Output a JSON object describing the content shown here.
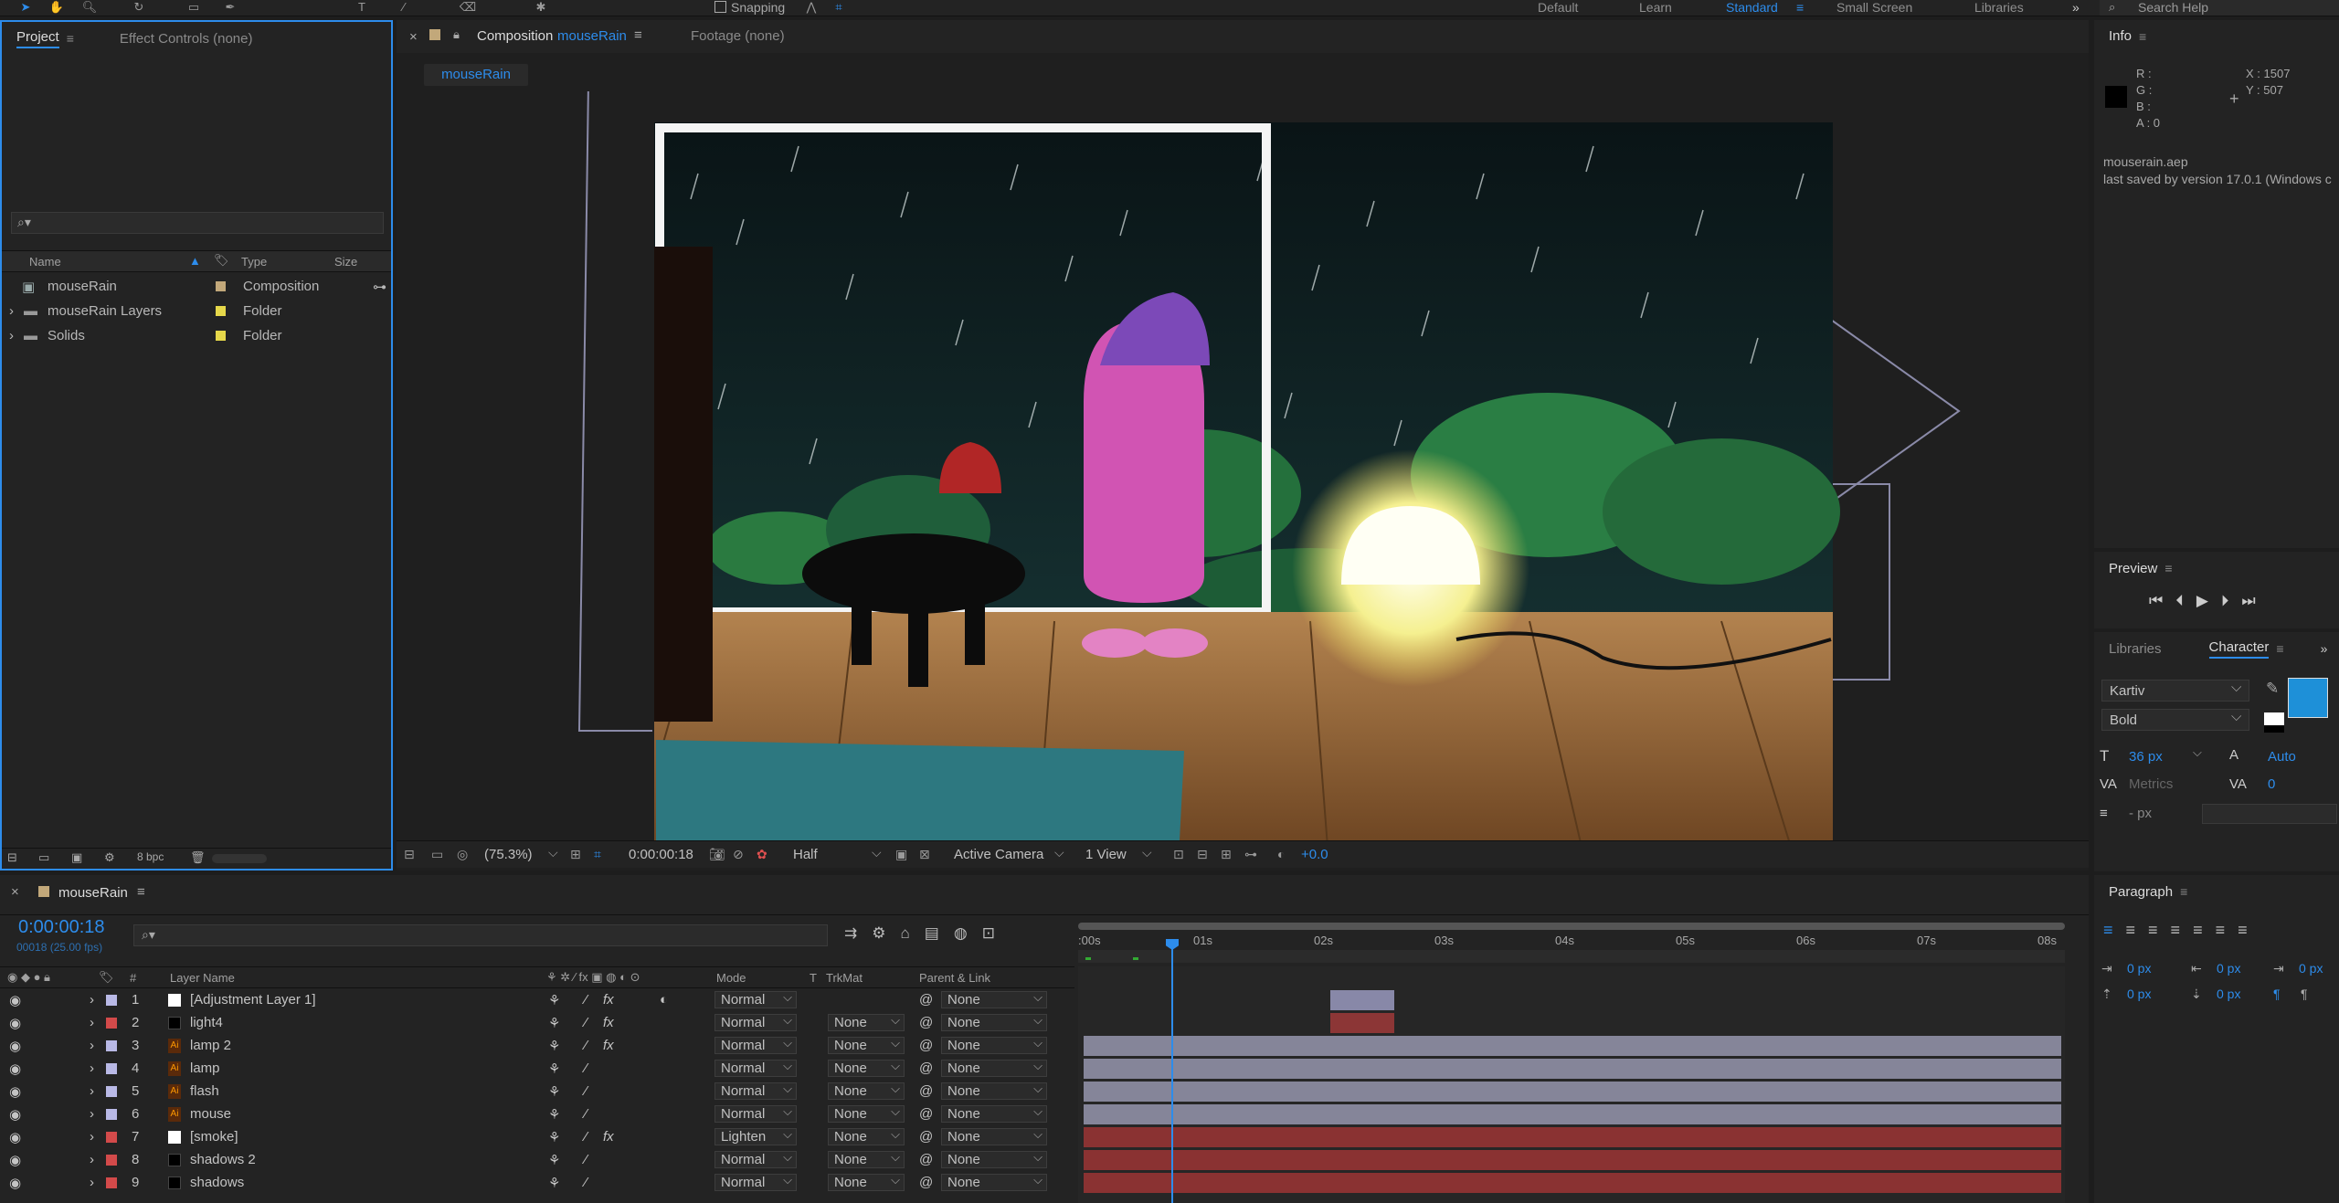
{
  "toolbar": {
    "snapping_label": "Snapping",
    "workspaces": [
      "Default",
      "Learn",
      "Standard",
      "Small Screen",
      "Libraries"
    ],
    "active_workspace": "Standard",
    "search_placeholder": "Search Help"
  },
  "project_panel": {
    "tabs": [
      "Project",
      "Effect Controls (none)"
    ],
    "columns": {
      "name": "Name",
      "type": "Type",
      "size": "Size"
    },
    "items": [
      {
        "name": "mouseRain",
        "type": "Composition",
        "color": "#c2a87a",
        "icon": "composition-icon"
      },
      {
        "name": "mouseRain Layers",
        "type": "Folder",
        "color": "#e6d84a",
        "icon": "folder-icon"
      },
      {
        "name": "Solids",
        "type": "Folder",
        "color": "#e6d84a",
        "icon": "folder-icon"
      }
    ],
    "bpc_label": "8 bpc"
  },
  "composition_panel": {
    "tab_prefix": "Composition",
    "tab_comp": "mouseRain",
    "footage_tab": "Footage (none)",
    "subtab": "mouseRain",
    "zoom": "(75.3%)",
    "timecode": "0:00:00:18",
    "resolution": "Half",
    "camera": "Active Camera",
    "views": "1 View",
    "exposure": "+0.0"
  },
  "info_panel": {
    "title": "Info",
    "r": "R :",
    "g": "G :",
    "b": "B :",
    "a": "A : 0",
    "x": "X : 1507",
    "y": "Y : 507",
    "file": "mouserain.aep",
    "saved": "last saved by version 17.0.1 (Windows c"
  },
  "preview_panel": {
    "title": "Preview"
  },
  "character_panel": {
    "tabs": [
      "Libraries",
      "Character"
    ],
    "font": "Kartiv",
    "style": "Bold",
    "size": "36 px",
    "leading": "Auto",
    "kerning": "Metrics",
    "tracking": "0",
    "stroke": "- px",
    "fill_color": "#1e90d8"
  },
  "paragraph_panel": {
    "title": "Paragraph",
    "indent_values": [
      "0 px",
      "0 px",
      "0 px",
      "0 px",
      "0 px"
    ]
  },
  "timeline": {
    "comp_tab": "mouseRain",
    "current_time": "0:00:00:18",
    "frame_info": "00018 (25.00 fps)",
    "columns": {
      "layer_name": "Layer Name",
      "mode": "Mode",
      "t": "T",
      "trkmat": "TrkMat",
      "parent": "Parent & Link"
    },
    "ruler": [
      "0s",
      "01s",
      "02s",
      "03s",
      "04s",
      "05s",
      "06s",
      "07s",
      "08s"
    ],
    "ruler_start_label": ":00s",
    "layers": [
      {
        "num": "1",
        "name": "[Adjustment Layer 1]",
        "label": "#b9b9e6",
        "swatch": "#ffffff",
        "mode": "Normal",
        "trkmat": "",
        "parent": "None",
        "fx": true,
        "bar": "short-purple"
      },
      {
        "num": "2",
        "name": "light4",
        "label": "#d34a4a",
        "swatch": "#000000",
        "mode": "Normal",
        "trkmat": "None",
        "parent": "None",
        "fx": true,
        "bar": "short-red"
      },
      {
        "num": "3",
        "name": "lamp 2",
        "label": "#b9b9e6",
        "swatch": "ai",
        "mode": "Normal",
        "trkmat": "None",
        "parent": "None",
        "fx": true,
        "bar": "full-purple"
      },
      {
        "num": "4",
        "name": "lamp",
        "label": "#b9b9e6",
        "swatch": "ai",
        "mode": "Normal",
        "trkmat": "None",
        "parent": "None",
        "fx": false,
        "bar": "full-purple"
      },
      {
        "num": "5",
        "name": "flash",
        "label": "#b9b9e6",
        "swatch": "ai",
        "mode": "Normal",
        "trkmat": "None",
        "parent": "None",
        "fx": false,
        "bar": "full-purple"
      },
      {
        "num": "6",
        "name": "mouse",
        "label": "#b9b9e6",
        "swatch": "ai",
        "mode": "Normal",
        "trkmat": "None",
        "parent": "None",
        "fx": false,
        "bar": "full-purple"
      },
      {
        "num": "7",
        "name": "[smoke]",
        "label": "#d34a4a",
        "swatch": "#ffffff",
        "mode": "Lighten",
        "trkmat": "None",
        "parent": "None",
        "fx": true,
        "bar": "full-red"
      },
      {
        "num": "8",
        "name": "shadows 2",
        "label": "#d34a4a",
        "swatch": "#000000",
        "mode": "Normal",
        "trkmat": "None",
        "parent": "None",
        "fx": false,
        "bar": "full-red"
      },
      {
        "num": "9",
        "name": "shadows",
        "label": "#d34a4a",
        "swatch": "#000000",
        "mode": "Normal",
        "trkmat": "None",
        "parent": "None",
        "fx": false,
        "bar": "full-red"
      }
    ]
  }
}
